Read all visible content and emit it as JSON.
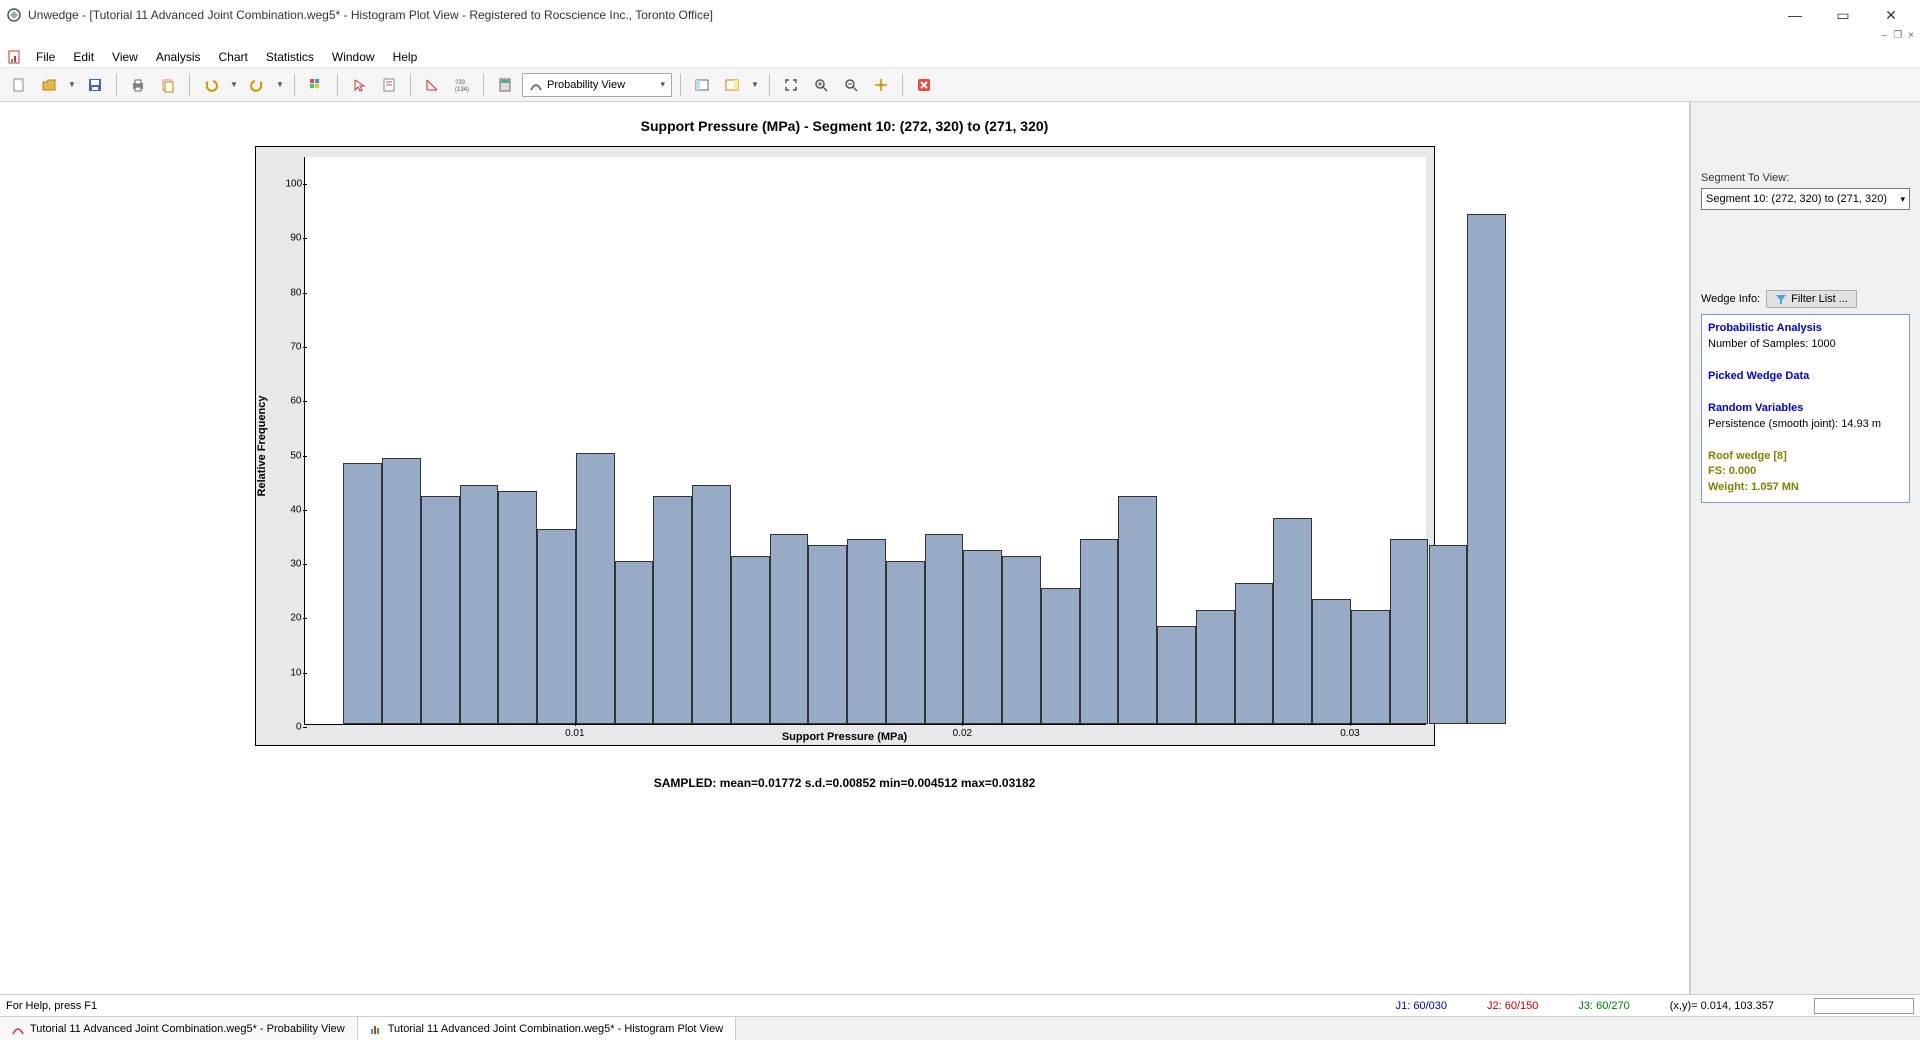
{
  "window": {
    "title": "Unwedge - [Tutorial 11 Advanced Joint Combination.weg5* - Histogram Plot View - Registered to Rocscience Inc., Toronto Office]"
  },
  "menu": {
    "items": [
      "File",
      "Edit",
      "View",
      "Analysis",
      "Chart",
      "Statistics",
      "Window",
      "Help"
    ]
  },
  "toolbar": {
    "view_select_label": "Probability View"
  },
  "chart": {
    "title": "Support Pressure (MPa) - Segment 10: (272, 320) to (271, 320)",
    "ylabel": "Relative Frequency",
    "xlabel": "Support Pressure (MPa)",
    "stats": "SAMPLED: mean=0.01772 s.d.=0.00852 min=0.004512 max=0.03182"
  },
  "side": {
    "segment_label": "Segment To View:",
    "segment_value": "Segment 10: (272, 320) to (271, 320)",
    "wedge_label": "Wedge Info:",
    "filter_label": "Filter List ...",
    "info_prob_hdr": "Probabilistic Analysis",
    "info_samples": "Number of Samples: 1000",
    "info_picked_hdr": "Picked Wedge Data",
    "info_rand_hdr": "Random Variables",
    "info_persist": "Persistence (smooth joint): 14.93 m",
    "info_roof": "Roof wedge [8]",
    "info_fs": "FS: 0.000",
    "info_weight": "Weight: 1.057 MN"
  },
  "status": {
    "help": "For Help, press F1",
    "j1": "J1: 60/030",
    "j2": "J2: 60/150",
    "j3": "J3: 60/270",
    "xy": "(x,y)= 0.014, 103.357"
  },
  "tabs": {
    "t1": "Tutorial 11 Advanced Joint Combination.weg5* - Probability View",
    "t2": "Tutorial 11 Advanced Joint Combination.weg5* - Histogram Plot View"
  },
  "chart_data": {
    "type": "bar",
    "title": "Support Pressure (MPa) - Segment 10: (272, 320) to (271, 320)",
    "xlabel": "Support Pressure (MPa)",
    "ylabel": "Relative Frequency",
    "x_ticks": [
      0.01,
      0.02,
      0.03
    ],
    "y_ticks": [
      0,
      10,
      20,
      30,
      40,
      50,
      60,
      70,
      80,
      90,
      100
    ],
    "ylim": [
      0,
      105
    ],
    "xlim": [
      0.003,
      0.032
    ],
    "bin_width": 0.001,
    "bars": [
      {
        "x": 0.0045,
        "y": 48
      },
      {
        "x": 0.0055,
        "y": 49
      },
      {
        "x": 0.0065,
        "y": 42
      },
      {
        "x": 0.0075,
        "y": 44
      },
      {
        "x": 0.0085,
        "y": 43
      },
      {
        "x": 0.0095,
        "y": 36
      },
      {
        "x": 0.0105,
        "y": 50
      },
      {
        "x": 0.0115,
        "y": 30
      },
      {
        "x": 0.0125,
        "y": 42
      },
      {
        "x": 0.0135,
        "y": 44
      },
      {
        "x": 0.0145,
        "y": 31
      },
      {
        "x": 0.0155,
        "y": 35
      },
      {
        "x": 0.0165,
        "y": 33
      },
      {
        "x": 0.0175,
        "y": 34
      },
      {
        "x": 0.0185,
        "y": 30
      },
      {
        "x": 0.0195,
        "y": 35
      },
      {
        "x": 0.0205,
        "y": 32
      },
      {
        "x": 0.0215,
        "y": 31
      },
      {
        "x": 0.0225,
        "y": 25
      },
      {
        "x": 0.0235,
        "y": 34
      },
      {
        "x": 0.0245,
        "y": 42
      },
      {
        "x": 0.0255,
        "y": 18
      },
      {
        "x": 0.0265,
        "y": 21
      },
      {
        "x": 0.0275,
        "y": 26
      },
      {
        "x": 0.0285,
        "y": 38
      },
      {
        "x": 0.0295,
        "y": 23
      },
      {
        "x": 0.0305,
        "y": 21
      },
      {
        "x": 0.0315,
        "y": 34
      },
      {
        "x": 0.0325,
        "y": 33
      },
      {
        "x": 0.0335,
        "y": 94
      }
    ]
  }
}
